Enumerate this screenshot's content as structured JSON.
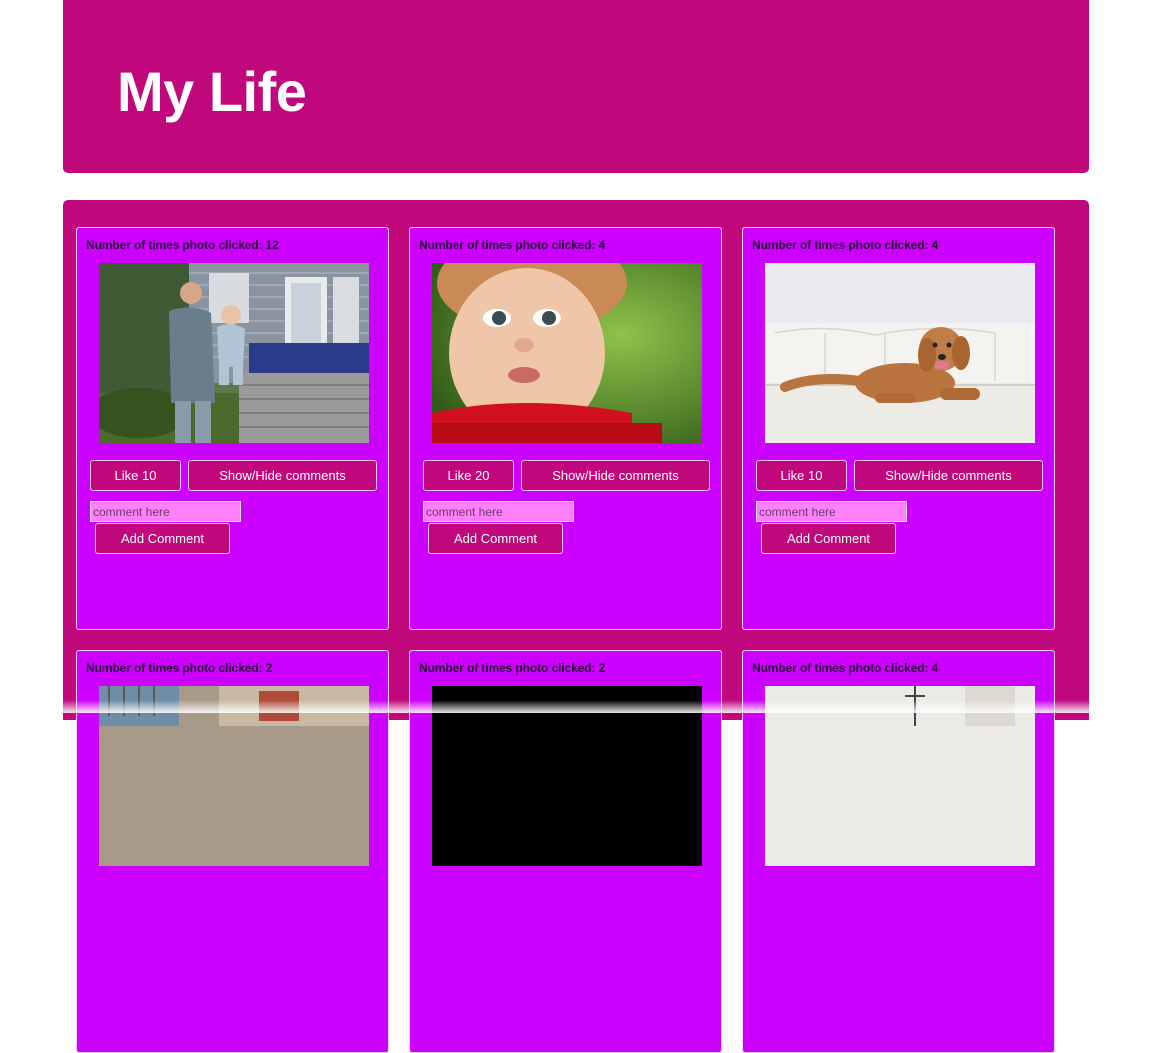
{
  "header": {
    "title": "My Life"
  },
  "cards": [
    {
      "clicks_label": "Number of times photo clicked: 12",
      "like_label": "Like 10",
      "toggle_label": "Show/Hide comments",
      "comment_placeholder": "comment here",
      "add_label": "Add Comment",
      "photo_icon": "father-and-baby-photo"
    },
    {
      "clicks_label": "Number of times photo clicked: 4",
      "like_label": "Like 20",
      "toggle_label": "Show/Hide comments",
      "comment_placeholder": "comment here",
      "add_label": "Add Comment",
      "photo_icon": "toddler-portrait-photo"
    },
    {
      "clicks_label": "Number of times photo clicked: 4",
      "like_label": "Like 10",
      "toggle_label": "Show/Hide comments",
      "comment_placeholder": "comment here",
      "add_label": "Add Comment",
      "photo_icon": "dog-on-couch-photo"
    },
    {
      "clicks_label": "Number of times photo clicked: 2",
      "photo_icon": "patio-photo"
    },
    {
      "clicks_label": "Number of times photo clicked: 2",
      "photo_icon": "dark-photo"
    },
    {
      "clicks_label": "Number of times photo clicked: 4",
      "photo_icon": "studio-photo"
    }
  ],
  "colors": {
    "header_bg": "#c0087c",
    "card_bg": "#cc00ff",
    "input_bg": "#ff80ff",
    "button_bg": "#c0087c"
  }
}
